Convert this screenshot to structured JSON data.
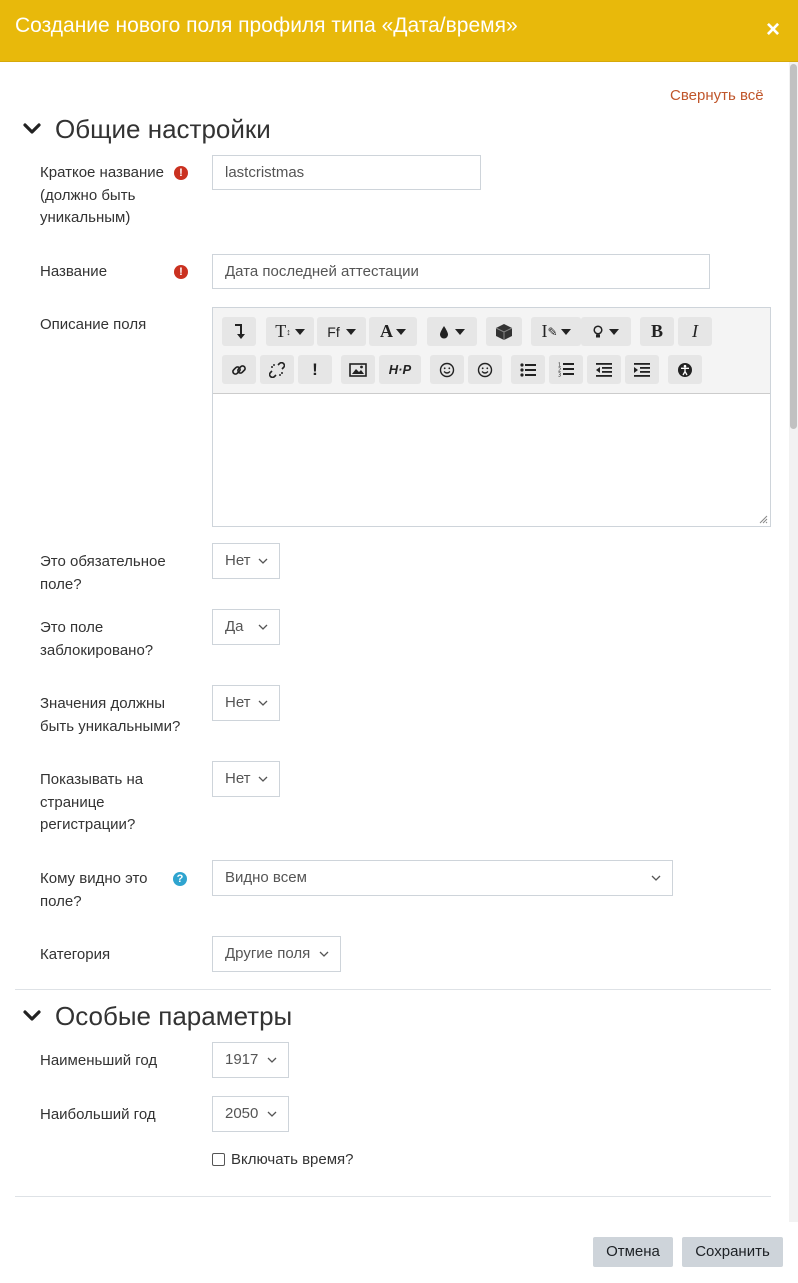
{
  "header": {
    "title": "Создание нового поля профиля типа «Дата/время»",
    "close_icon": "close-icon"
  },
  "collapse_all": "Свернуть всё",
  "sections": {
    "general": {
      "title": "Общие настройки"
    },
    "specific": {
      "title": "Особые параметры"
    }
  },
  "fields": {
    "shortname": {
      "label": "Краткое название (должно быть уникальным)",
      "value": "lastcristmas",
      "required_icon": "exclamation-icon"
    },
    "name": {
      "label": "Название",
      "value": "Дата последней аттестации",
      "required_icon": "exclamation-icon"
    },
    "description": {
      "label": "Описание поля",
      "value": ""
    },
    "required": {
      "label": "Это обязательное поле?",
      "value": "Нет"
    },
    "locked": {
      "label": "Это поле заблокировано?",
      "value": "Да"
    },
    "unique": {
      "label": "Значения должны быть уникальными?",
      "value": "Нет"
    },
    "signup": {
      "label": "Показывать на странице регистрации?",
      "value": "Нет"
    },
    "visible": {
      "label": "Кому видно это поле?",
      "value": "Видно всем",
      "help_icon": "question-icon"
    },
    "category": {
      "label": "Категория",
      "value": "Другие поля"
    },
    "startyear": {
      "label": "Наименьший год",
      "value": "1917"
    },
    "endyear": {
      "label": "Наибольший год",
      "value": "2050"
    },
    "includetime": {
      "label": "Включать время?",
      "checked": false
    }
  },
  "toolbar": {
    "font_label": "Ff",
    "row1_icons": [
      "collapse-icon",
      "text-size-icon",
      "font-family-icon",
      "font-color-icon",
      "background-color-icon",
      "box-icon",
      "clear-format-icon",
      "lightbulb-icon",
      "bold-icon",
      "italic-icon"
    ],
    "row2_icons": [
      "link-icon",
      "unlink-icon",
      "exclamation-icon",
      "image-icon",
      "h5p-icon",
      "emoji-icon",
      "emoticon-icon",
      "unordered-list-icon",
      "ordered-list-icon",
      "outdent-icon",
      "indent-icon",
      "accessibility-icon"
    ]
  },
  "buttons": {
    "cancel": "Отмена",
    "save": "Сохранить"
  },
  "colors": {
    "header": "#e8b90b",
    "link": "#c0562b",
    "required": "#ca3120",
    "help": "#2fa4cf"
  }
}
